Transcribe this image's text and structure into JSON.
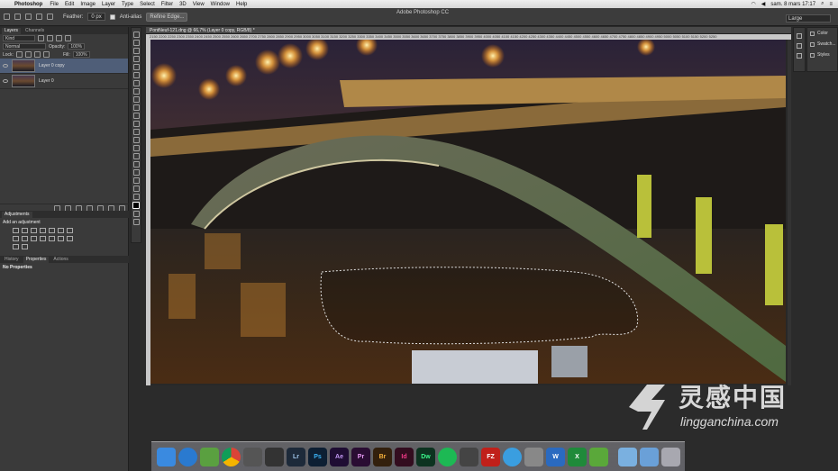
{
  "menubar": {
    "app": "Photoshop",
    "items": [
      "File",
      "Edit",
      "Image",
      "Layer",
      "Type",
      "Select",
      "Filter",
      "3D",
      "View",
      "Window",
      "Help"
    ],
    "datetime": "sam. 8 mars 17:17"
  },
  "options": {
    "feather_label": "Feather:",
    "feather_value": "0 px",
    "antialias_label": "Anti-alias",
    "refine_edge": "Refine Edge...",
    "window_title": "Adobe Photoshop CC",
    "workspace": "Large"
  },
  "layers_panel": {
    "tabs": [
      "Layers",
      "Channels"
    ],
    "kind": "Kind",
    "blend_mode": "Normal",
    "opacity_label": "Opacity:",
    "opacity_value": "100%",
    "lock_label": "Lock:",
    "fill_label": "Fill:",
    "fill_value": "100%",
    "layers": [
      "Layer 0 copy",
      "Layer 0"
    ]
  },
  "adjustments_panel": {
    "title": "Adjustments",
    "subtitle": "Add an adjustment"
  },
  "properties_panel": {
    "tabs": [
      "History",
      "Properties",
      "Actions"
    ],
    "content": "No Properties"
  },
  "document": {
    "tab": "PontNeuf-121.dng @ 66,7% (Layer 0 copy, RGB/8) *",
    "ruler": "2150 2200 2250 2300 2350 2400 2450 2500 2550 2600 2650 2700 2750 2800 2850 2900 2950 3000 3050 3100 3150 3200 3250 3300 3350 3400 3450 3500 3550 3600 3650 3700 3750 3800 3850 3900 3950 4000 4050 4100 4150 4200 4250 4300 4350 4400 4450 4500 4550 4600 4650 4700 4750 4800 4850 4900 4950 5000 5050 5100 5150 5200 5250"
  },
  "right_panel": {
    "items": [
      "Color",
      "Swatch...",
      "Styles"
    ]
  },
  "dock": {
    "apps": [
      "Finder",
      "Safari",
      "Mail",
      "Chrome",
      "Preview",
      "Bridge",
      "Lr",
      "Ps",
      "Ae",
      "Pr",
      "Br",
      "Id",
      "Dw",
      "Spotify",
      "Clapper",
      "FZ",
      "iTunes",
      "Utility",
      "W",
      "X",
      "Evernote",
      "Folder",
      "Downloads",
      "Trash"
    ]
  },
  "watermark": {
    "cn": "灵感中国",
    "en": "lingganchina.com"
  }
}
